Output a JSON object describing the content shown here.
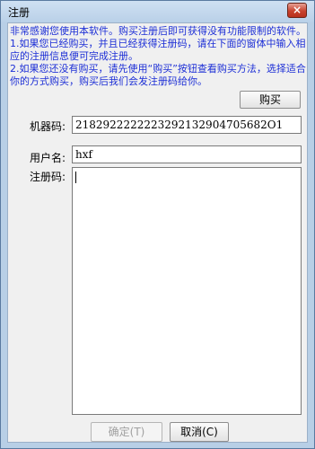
{
  "window": {
    "title": "注册",
    "close_label": "×"
  },
  "info": {
    "line1": "    非常感谢您使用本软件。购买注册后即可获得没有功能限制的软件。",
    "line2": "    1.如果您已经购买，并且已经获得注册码，请在下面的窗体中输入相应的注册信息便可完成注册。",
    "line3": "    2.如果您还没有购买，请先使用“购买”按钮查看购买方法，选择适合你的方式购买，购买后我们会发注册码给你。"
  },
  "buttons": {
    "buy": "购买",
    "ok": "确定(T)",
    "cancel": "取消(C)"
  },
  "fields": {
    "machine_label": "机器码:",
    "machine_value": "2182922222223292132904705682O1",
    "user_label": "用户名:",
    "user_value": "hxf",
    "reg_label": "注册码:",
    "reg_value": ""
  },
  "colors": {
    "info_text": "#1d2fd6",
    "window_frame": "#b8cfe6"
  }
}
